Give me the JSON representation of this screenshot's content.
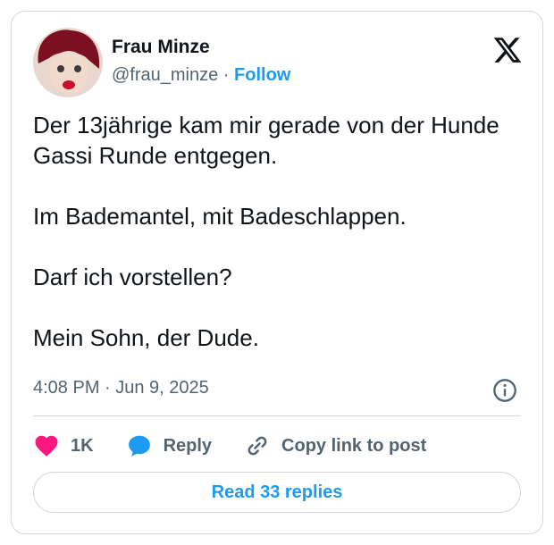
{
  "author": {
    "name": "Frau Minze",
    "handle": "@frau_minze",
    "separator": " · ",
    "follow_label": "Follow"
  },
  "tweet": {
    "paragraphs": [
      "Der 13jährige kam mir gerade von der Hunde Gassi Runde entgegen.",
      "Im Bademantel, mit Badeschlappen.",
      "Darf ich vorstellen?",
      "Mein Sohn, der Dude."
    ],
    "timestamp": "4:08 PM · Jun 9, 2025"
  },
  "actions": {
    "likes": "1K",
    "reply_label": "Reply",
    "copy_label": "Copy link to post"
  },
  "read_replies_label": "Read 33 replies",
  "colors": {
    "accent": "#1d9bf0",
    "like": "#f91880",
    "muted": "#536471",
    "border": "#cfd9de"
  }
}
